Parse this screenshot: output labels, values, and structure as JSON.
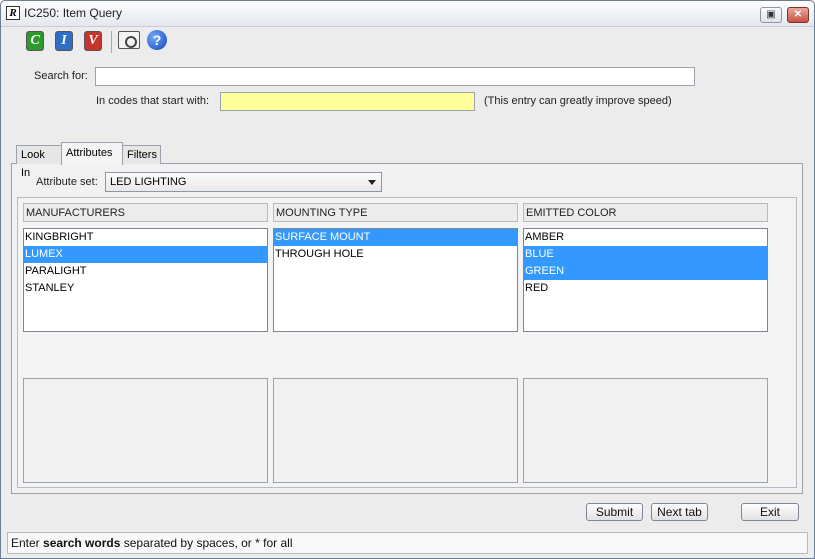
{
  "window": {
    "app_icon_glyph": "R",
    "title": "IC250: Item Query",
    "restore_glyph": "▣",
    "close_glyph": "✕"
  },
  "toolbar": {
    "items": [
      {
        "icon": "c-icon",
        "glyph": "C",
        "color": "#2c9a2c"
      },
      {
        "icon": "i-icon",
        "glyph": "I",
        "color": "#2f6ec7"
      },
      {
        "icon": "v-icon",
        "glyph": "V",
        "color": "#c7342c"
      },
      {
        "icon": "camera-icon"
      },
      {
        "icon": "help-icon",
        "glyph": "?"
      }
    ]
  },
  "search": {
    "label": "Search for:",
    "value": "",
    "codes_label": "In codes that start with:",
    "codes_value": "",
    "codes_hint": "(This entry can greatly improve speed)"
  },
  "tabs": [
    {
      "label": "Look In",
      "active": false
    },
    {
      "label": "Attributes",
      "active": true
    },
    {
      "label": "Filters",
      "active": false
    }
  ],
  "attribute_set": {
    "label": "Attribute set:",
    "selected": "LED LIGHTING"
  },
  "attributes": [
    {
      "header": "MANUFACTURERS",
      "items": [
        {
          "text": "KINGBRIGHT",
          "selected": false
        },
        {
          "text": "LUMEX",
          "selected": true
        },
        {
          "text": "PARALIGHT",
          "selected": false
        },
        {
          "text": "STANLEY",
          "selected": false
        }
      ]
    },
    {
      "header": "MOUNTING TYPE",
      "items": [
        {
          "text": "SURFACE MOUNT",
          "selected": true
        },
        {
          "text": "THROUGH HOLE",
          "selected": false
        }
      ]
    },
    {
      "header": "EMITTED COLOR",
      "items": [
        {
          "text": "AMBER",
          "selected": false
        },
        {
          "text": "BLUE",
          "selected": true
        },
        {
          "text": "GREEN",
          "selected": true
        },
        {
          "text": "RED",
          "selected": false
        }
      ]
    }
  ],
  "buttons": {
    "submit": "Submit",
    "next_tab": "Next tab",
    "exit": "Exit"
  },
  "status": {
    "prefix": "Enter ",
    "bold": "search words",
    "suffix": " separated by spaces, or * for all"
  },
  "colors": {
    "selection": "#3399ff",
    "codes_field": "#ffff9c"
  }
}
